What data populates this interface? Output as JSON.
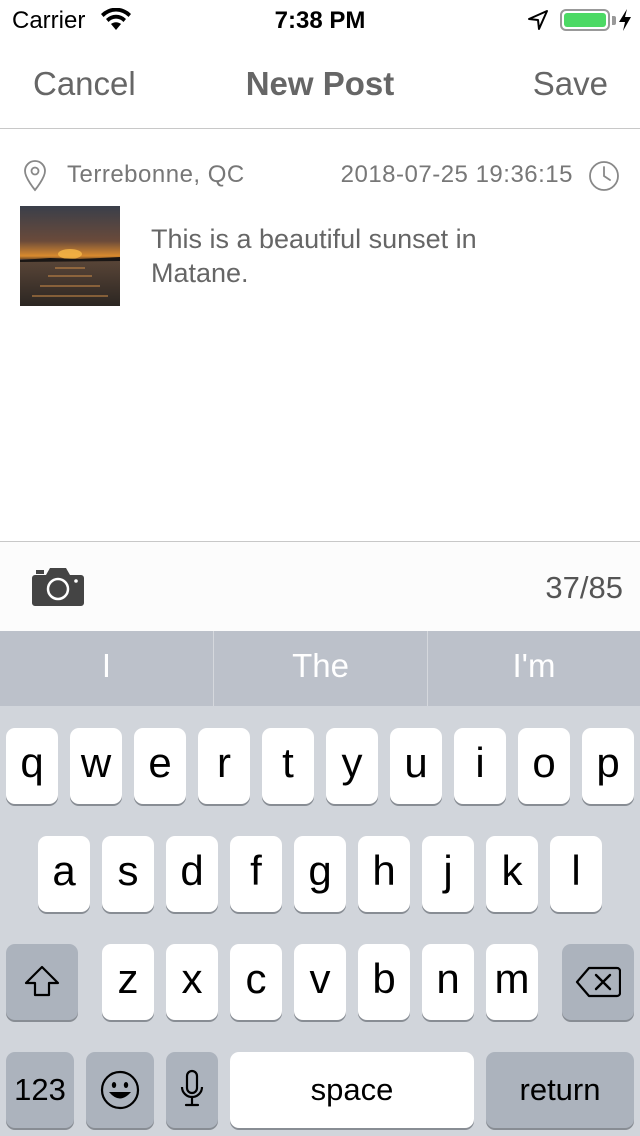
{
  "status_bar": {
    "carrier": "Carrier",
    "time": "7:38 PM",
    "battery_level": 1.0,
    "icons": [
      "wifi-icon",
      "location-arrow-icon",
      "battery-icon",
      "charging-bolt-icon"
    ]
  },
  "nav": {
    "cancel_label": "Cancel",
    "title": "New Post",
    "save_label": "Save"
  },
  "post": {
    "location": "Terrebonne, QC",
    "datetime": "2018-07-25 19:36:15",
    "text_line1": "This is a beautiful sunset in",
    "text_line2": "Matane.",
    "photo_icon": "sunset-photo-thumbnail"
  },
  "toolbar": {
    "char_count": "37/85",
    "camera_icon": "camera-icon"
  },
  "keyboard": {
    "predictions": [
      "I",
      "The",
      "I'm"
    ],
    "row1": [
      "q",
      "w",
      "e",
      "r",
      "t",
      "y",
      "u",
      "i",
      "o",
      "p"
    ],
    "row2": [
      "a",
      "s",
      "d",
      "f",
      "g",
      "h",
      "j",
      "k",
      "l"
    ],
    "row3": [
      "z",
      "x",
      "c",
      "v",
      "b",
      "n",
      "m"
    ],
    "numbers_label": "123",
    "space_label": "space",
    "return_label": "return"
  },
  "colors": {
    "battery_green": "#4cd964",
    "keyboard_bg": "#d1d5db",
    "prediction_bar": "#bcc1ca",
    "text_gray": "#666666"
  }
}
